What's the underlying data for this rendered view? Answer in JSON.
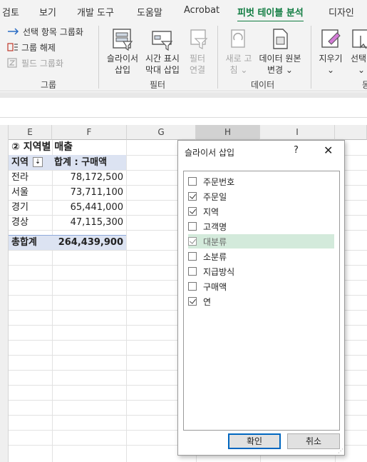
{
  "ribbon_tabs": [
    "검토",
    "보기",
    "개발 도구",
    "도움말",
    "Acrobat",
    "피벗 테이블 분석",
    "디자인"
  ],
  "ribbon": {
    "group_btns": [
      {
        "label": "선택 항목 그룹화",
        "icon": "group-selection-icon"
      },
      {
        "label": "그룹 해제",
        "icon": "ungroup-icon"
      },
      {
        "label": "필드 그룹화",
        "icon": "group-field-icon"
      }
    ],
    "group_label": "그룹",
    "filter": {
      "slicer_line1": "슬라이서",
      "slicer_line2": "삽입",
      "timeline_line1": "시간 표시",
      "timeline_line2": "막대 삽입",
      "conn_line1": "필터",
      "conn_line2": "연결",
      "label": "필터"
    },
    "data": {
      "refresh_line1": "새로 고",
      "refresh_line2": "침 ⌄",
      "source_line1": "데이터 원본",
      "source_line2": "변경 ⌄",
      "label": "데이터"
    },
    "actions": {
      "clear_line1": "지우기",
      "clear_line2": "⌄",
      "select_line1": "선택",
      "select_line2": "⌄",
      "label_partial": "동"
    }
  },
  "columns": [
    "E",
    "F",
    "G",
    "H",
    "I"
  ],
  "pivot": {
    "title": "② 지역별 매출",
    "header_region": "지역",
    "header_sum": "합계 : 구매액",
    "rows": [
      {
        "region": "전라",
        "value": "78,172,500"
      },
      {
        "region": "서울",
        "value": "73,711,100"
      },
      {
        "region": "경기",
        "value": "65,441,000"
      },
      {
        "region": "경상",
        "value": "47,115,300"
      }
    ],
    "total_label": "총합계",
    "total_value": "264,439,900"
  },
  "dialog": {
    "title": "슬라이서 삽입",
    "help": "?",
    "close": "✕",
    "fields": [
      {
        "label": "주문번호",
        "checked": false
      },
      {
        "label": "주문일",
        "checked": true
      },
      {
        "label": "지역",
        "checked": true
      },
      {
        "label": "고객명",
        "checked": false
      },
      {
        "label": "대분류",
        "checked": true
      },
      {
        "label": "소분류",
        "checked": false
      },
      {
        "label": "지급방식",
        "checked": false
      },
      {
        "label": "구매액",
        "checked": false
      },
      {
        "label": "연",
        "checked": true
      }
    ],
    "ok_label": "확인",
    "cancel_label": "취소"
  },
  "colors": {
    "accent": "#107c41",
    "pivot_band": "#dce3f2",
    "highlight": "#d3eadb",
    "ok_border": "#0067c0"
  }
}
